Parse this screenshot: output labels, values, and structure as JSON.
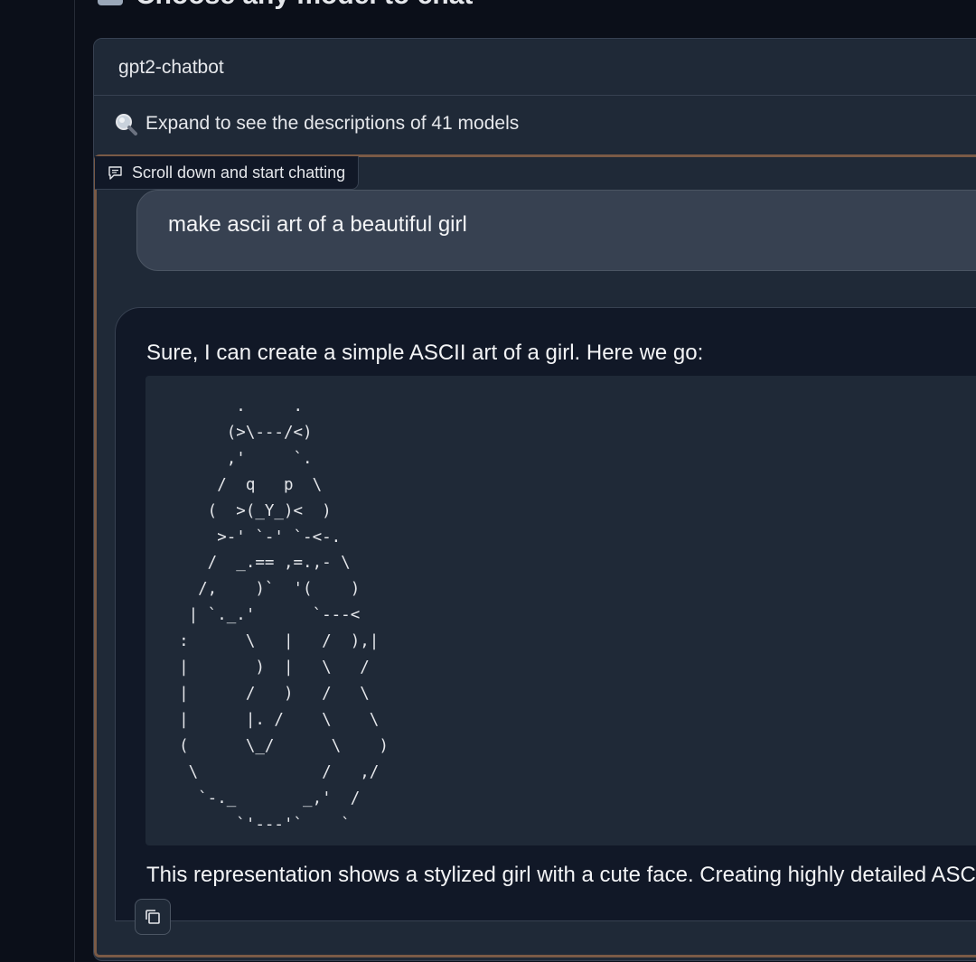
{
  "header": {
    "title": "Choose any model to chat"
  },
  "model_selector": {
    "selected": "gpt2-chatbot"
  },
  "model_info": {
    "expand_label": "Expand to see the descriptions of 41 models"
  },
  "chat": {
    "badge_label": "Scroll down and start chatting",
    "messages": [
      {
        "role": "user",
        "text": "make ascii art of a beautiful girl"
      },
      {
        "role": "assistant",
        "intro": "Sure, I can create a simple ASCII art of a girl. Here we go:",
        "code": "        .     .\n       (>\\---/<)\n       ,'     `.\n      /  q   p  \\\n     (  >(_Y_)<  )\n      >-' `-' `-<-.\n     /  _.== ,=.,- \\\n    /,    )`  '(    )\n   | `._.'      `---<\n  :      \\   |   /  ),|\n  |       )  |   \\   /\n  |      /   )   /   \\\n  |      |. /    \\    \\\n  (      \\_/      \\    )\n   \\             /   ,/\n    `-._       _,'  /\n        `'---'`    `",
        "outro": "This representation shows a stylized girl with a cute face. Creating highly detailed ASCII"
      }
    ]
  },
  "icons": {
    "heading": "robot-icon",
    "expand": "magnifier-icon",
    "badge": "chat-bubble-icon",
    "copy": "copy-icon"
  },
  "colors": {
    "background": "#0b0f19",
    "panel": "#1f2937",
    "frame_accent": "#7a5a46",
    "user_bubble": "#374151",
    "bot_bubble": "#111827"
  }
}
